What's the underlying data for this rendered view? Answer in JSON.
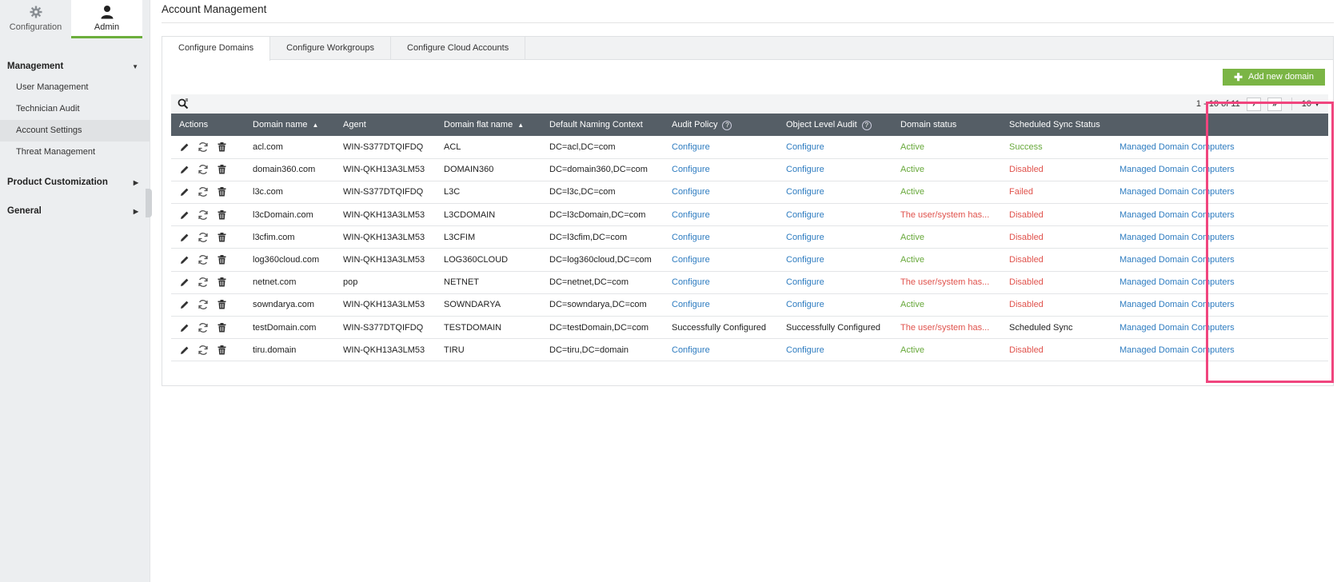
{
  "topnav": [
    {
      "label": "Configuration",
      "icon": "gear-icon",
      "active": false
    },
    {
      "label": "Admin",
      "icon": "user-icon",
      "active": true
    }
  ],
  "menu": {
    "management": {
      "label": "Management",
      "items": [
        "User Management",
        "Technician Audit",
        "Account Settings",
        "Threat Management"
      ],
      "active": "Account Settings"
    },
    "product_customization": "Product Customization",
    "general": "General"
  },
  "page_title": "Account Management",
  "tabs": [
    "Configure Domains",
    "Configure Workgroups",
    "Configure Cloud Accounts"
  ],
  "add_button": "Add new domain",
  "pager": {
    "range": "1 - 10 of 11",
    "page_size": "10"
  },
  "columns": [
    "Actions",
    "Domain name",
    "Agent",
    "Domain flat name",
    "Default Naming Context",
    "Audit Policy",
    "Object Level Audit",
    "Domain status",
    "Scheduled Sync Status",
    ""
  ],
  "rows": [
    {
      "domain": "acl.com",
      "agent": "WIN-S377DTQIFDQ",
      "flat": "ACL",
      "context": "DC=acl,DC=com",
      "audit": "Configure",
      "object_audit": "Configure",
      "status": "Active",
      "sync": "Success",
      "link": "Managed Domain Computers"
    },
    {
      "domain": "domain360.com",
      "agent": "WIN-QKH13A3LM53",
      "flat": "DOMAIN360",
      "context": "DC=domain360,DC=com",
      "audit": "Configure",
      "object_audit": "Configure",
      "status": "Active",
      "sync": "Disabled",
      "link": "Managed Domain Computers"
    },
    {
      "domain": "l3c.com",
      "agent": "WIN-S377DTQIFDQ",
      "flat": "L3C",
      "context": "DC=l3c,DC=com",
      "audit": "Configure",
      "object_audit": "Configure",
      "status": "Active",
      "sync": "Failed",
      "link": "Managed Domain Computers"
    },
    {
      "domain": "l3cDomain.com",
      "agent": "WIN-QKH13A3LM53",
      "flat": "L3CDOMAIN",
      "context": "DC=l3cDomain,DC=com",
      "audit": "Configure",
      "object_audit": "Configure",
      "status": "The user/system has...",
      "sync": "Disabled",
      "link": "Managed Domain Computers"
    },
    {
      "domain": "l3cfim.com",
      "agent": "WIN-QKH13A3LM53",
      "flat": "L3CFIM",
      "context": "DC=l3cfim,DC=com",
      "audit": "Configure",
      "object_audit": "Configure",
      "status": "Active",
      "sync": "Disabled",
      "link": "Managed Domain Computers"
    },
    {
      "domain": "log360cloud.com",
      "agent": "WIN-QKH13A3LM53",
      "flat": "LOG360CLOUD",
      "context": "DC=log360cloud,DC=com",
      "audit": "Configure",
      "object_audit": "Configure",
      "status": "Active",
      "sync": "Disabled",
      "link": "Managed Domain Computers"
    },
    {
      "domain": "netnet.com",
      "agent": "pop",
      "flat": "NETNET",
      "context": "DC=netnet,DC=com",
      "audit": "Configure",
      "object_audit": "Configure",
      "status": "The user/system has...",
      "sync": "Disabled",
      "link": "Managed Domain Computers"
    },
    {
      "domain": "sowndarya.com",
      "agent": "WIN-QKH13A3LM53",
      "flat": "SOWNDARYA",
      "context": "DC=sowndarya,DC=com",
      "audit": "Configure",
      "object_audit": "Configure",
      "status": "Active",
      "sync": "Disabled",
      "link": "Managed Domain Computers"
    },
    {
      "domain": "testDomain.com",
      "agent": "WIN-S377DTQIFDQ",
      "flat": "TESTDOMAIN",
      "context": "DC=testDomain,DC=com",
      "audit": "Successfully Configured",
      "object_audit": "Successfully Configured",
      "status": "The user/system has...",
      "sync": "Scheduled Sync",
      "link": "Managed Domain Computers"
    },
    {
      "domain": "tiru.domain",
      "agent": "WIN-QKH13A3LM53",
      "flat": "TIRU",
      "context": "DC=tiru,DC=domain",
      "audit": "Configure",
      "object_audit": "Configure",
      "status": "Active",
      "sync": "Disabled",
      "link": "Managed Domain Computers"
    }
  ],
  "colors": {
    "accent_green": "#7bb545",
    "link_blue": "#2e7cc0",
    "status_green": "#67a83a",
    "status_red": "#e0524c",
    "highlight": "#f0457e",
    "header_bg": "#555e66"
  }
}
